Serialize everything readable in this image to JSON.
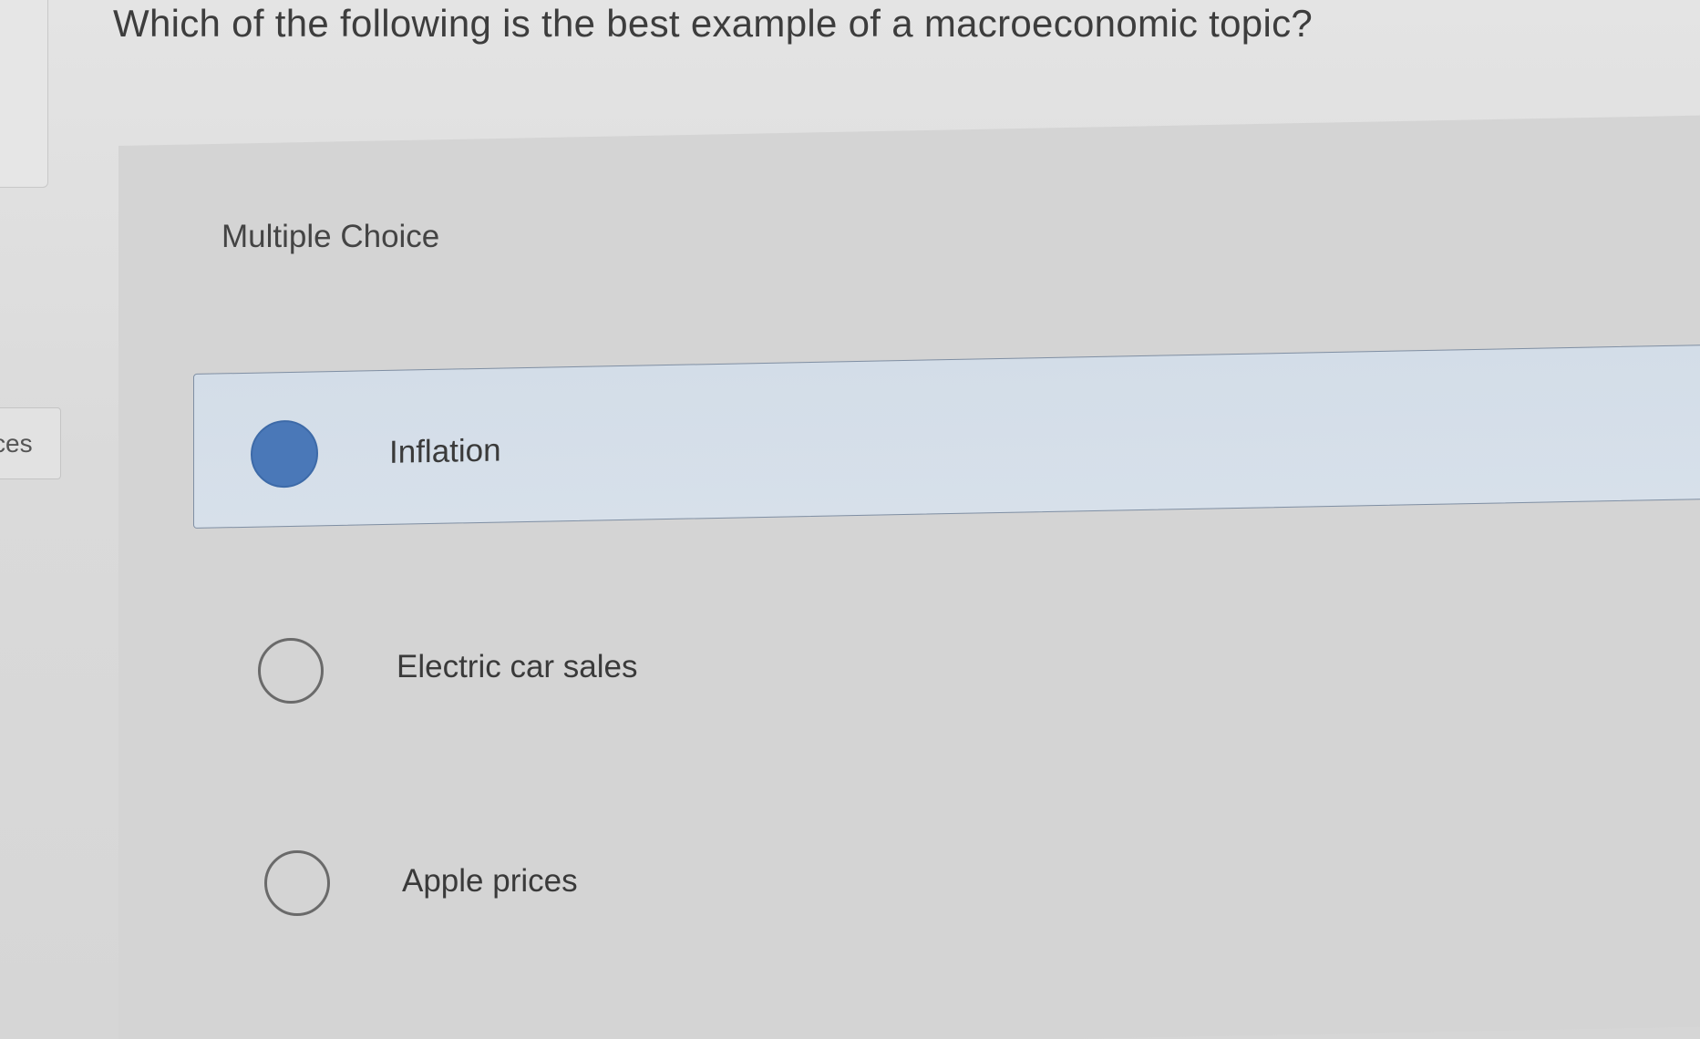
{
  "question": {
    "text": "Which of the following is the best example of a macroeconomic topic?"
  },
  "side_tab": {
    "label": "ces"
  },
  "multiple_choice": {
    "label": "Multiple Choice",
    "options": [
      {
        "label": "Inflation",
        "selected": true
      },
      {
        "label": "Electric car sales",
        "selected": false
      },
      {
        "label": "Apple prices",
        "selected": false
      }
    ]
  },
  "colors": {
    "selected_fill": "#4a78b8",
    "selected_background": "#d5dfe9",
    "selected_border": "#7f8fa4",
    "radio_outline": "#6a6a6a"
  }
}
